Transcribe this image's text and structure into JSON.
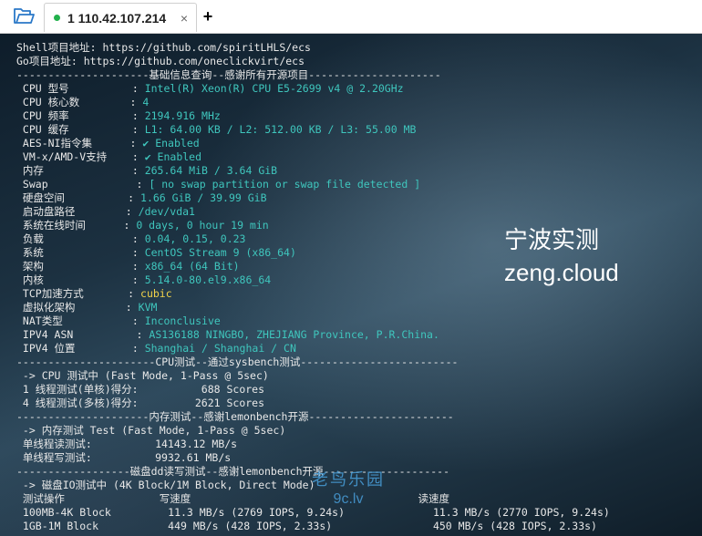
{
  "tab": {
    "title": "1 110.42.107.214",
    "close": "×",
    "new": "+"
  },
  "overlay": {
    "line1": "宁波实测",
    "line2": "zeng.cloud"
  },
  "watermark": {
    "line1": "老鸟乐园",
    "line2": "9c.lv"
  },
  "colors": {
    "accent_cyan": "#3fc6bd",
    "highlight_yellow": "#f2d34a",
    "tab_dot": "#22b14c"
  },
  "terminal": {
    "lines": [
      [
        {
          "t": "Shell项目地址: https://github.com/spiritLHLS/ecs",
          "c": "w"
        }
      ],
      [
        {
          "t": "Go项目地址: https://github.com/oneclickvirt/ecs",
          "c": "w"
        }
      ],
      [
        {
          "t": "---------------------基础信息查询--感谢所有开源项目---------------------",
          "c": "w"
        }
      ],
      [
        {
          "t": " CPU 型号          : ",
          "c": "w"
        },
        {
          "t": "Intel(R) Xeon(R) CPU E5-2699 v4 @ 2.20GHz",
          "c": "c"
        }
      ],
      [
        {
          "t": " CPU 核心数        : ",
          "c": "w"
        },
        {
          "t": "4",
          "c": "c"
        }
      ],
      [
        {
          "t": " CPU 频率          : ",
          "c": "w"
        },
        {
          "t": "2194.916 MHz",
          "c": "c"
        }
      ],
      [
        {
          "t": " CPU 缓存          : ",
          "c": "w"
        },
        {
          "t": "L1: 64.00 KB / L2: 512.00 KB / L3: 55.00 MB",
          "c": "c"
        }
      ],
      [
        {
          "t": " AES-NI指令集      : ",
          "c": "w"
        },
        {
          "t": "✔ Enabled",
          "c": "c"
        }
      ],
      [
        {
          "t": " VM-x/AMD-V支持    : ",
          "c": "w"
        },
        {
          "t": "✔ Enabled",
          "c": "c"
        }
      ],
      [
        {
          "t": " 内存              : ",
          "c": "w"
        },
        {
          "t": "265.64 MiB / 3.64 GiB",
          "c": "c"
        }
      ],
      [
        {
          "t": " Swap              : ",
          "c": "w"
        },
        {
          "t": "[ no swap partition or swap file detected ]",
          "c": "c"
        }
      ],
      [
        {
          "t": " 硬盘空间          : ",
          "c": "w"
        },
        {
          "t": "1.66 GiB / 39.99 GiB",
          "c": "c"
        }
      ],
      [
        {
          "t": " 启动盘路径        : ",
          "c": "w"
        },
        {
          "t": "/dev/vda1",
          "c": "c"
        }
      ],
      [
        {
          "t": " 系统在线时间      : ",
          "c": "w"
        },
        {
          "t": "0 days, 0 hour 19 min",
          "c": "c"
        }
      ],
      [
        {
          "t": " 负载              : ",
          "c": "w"
        },
        {
          "t": "0.04, 0.15, 0.23",
          "c": "c"
        }
      ],
      [
        {
          "t": " 系统              : ",
          "c": "w"
        },
        {
          "t": "CentOS Stream 9 (x86_64)",
          "c": "c"
        }
      ],
      [
        {
          "t": " 架构              : ",
          "c": "w"
        },
        {
          "t": "x86_64 (64 Bit)",
          "c": "c"
        }
      ],
      [
        {
          "t": " 内核              : ",
          "c": "w"
        },
        {
          "t": "5.14.0-80.el9.x86_64",
          "c": "c"
        }
      ],
      [
        {
          "t": " TCP加速方式       : ",
          "c": "w"
        },
        {
          "t": "cubic",
          "c": "y"
        }
      ],
      [
        {
          "t": " 虚拟化架构        : ",
          "c": "w"
        },
        {
          "t": "KVM",
          "c": "c"
        }
      ],
      [
        {
          "t": " NAT类型           : ",
          "c": "w"
        },
        {
          "t": "Inconclusive",
          "c": "c"
        }
      ],
      [
        {
          "t": " IPV4 ASN          : ",
          "c": "w"
        },
        {
          "t": "AS136188 NINGBO, ZHEJIANG Province, P.R.China.",
          "c": "c"
        }
      ],
      [
        {
          "t": " IPV4 位置         : ",
          "c": "w"
        },
        {
          "t": "Shanghai / Shanghai / CN",
          "c": "c"
        }
      ],
      [
        {
          "t": "----------------------CPU测试--通过sysbench测试-------------------------",
          "c": "w"
        }
      ],
      [
        {
          "t": " -> CPU 测试中 (Fast Mode, 1-Pass @ 5sec)",
          "c": "w"
        }
      ],
      [
        {
          "t": " 1 线程测试(单核)得分:          688 Scores",
          "c": "w"
        }
      ],
      [
        {
          "t": " 4 线程测试(多核)得分:         2621 Scores",
          "c": "w"
        }
      ],
      [
        {
          "t": "---------------------内存测试--感谢lemonbench开源-----------------------",
          "c": "w"
        }
      ],
      [
        {
          "t": " -> 内存测试 Test (Fast Mode, 1-Pass @ 5sec)",
          "c": "w"
        }
      ],
      [
        {
          "t": " 单线程读测试:          14143.12 MB/s",
          "c": "w"
        }
      ],
      [
        {
          "t": " 单线程写测试:          9932.61 MB/s",
          "c": "w"
        }
      ],
      [
        {
          "t": "------------------磁盘dd读写测试--感谢lemonbench开源--------------------",
          "c": "w"
        }
      ],
      [
        {
          "t": " -> 磁盘IO测试中 (4K Block/1M Block, Direct Mode)",
          "c": "w"
        }
      ],
      [
        {
          "t": " 测试操作               写速度                                    读速度",
          "c": "w"
        }
      ],
      [
        {
          "t": " 100MB-4K Block         11.3 MB/s (2769 IOPS, 9.24s)              11.3 MB/s (2770 IOPS, 9.24s)",
          "c": "w"
        }
      ],
      [
        {
          "t": " 1GB-1M Block           449 MB/s (428 IOPS, 2.33s)                450 MB/s (428 IOPS, 2.33s)",
          "c": "w"
        }
      ]
    ]
  }
}
